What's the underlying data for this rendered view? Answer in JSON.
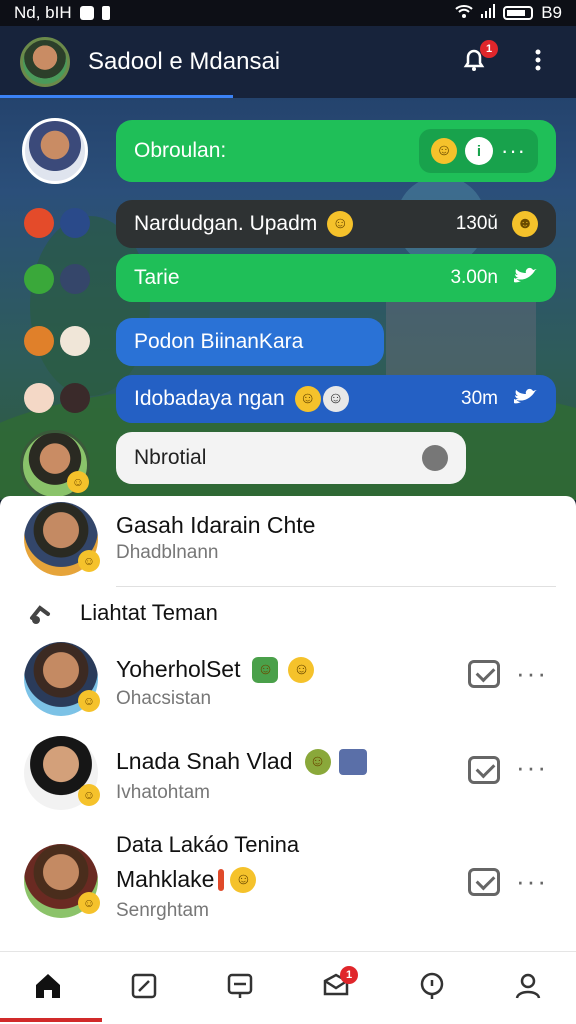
{
  "status_bar": {
    "carrier": "Nd, bIH",
    "time": "B9"
  },
  "header": {
    "title": "Sadool e Mdansai",
    "notif_badge": "1"
  },
  "chat": [
    {
      "text": "Obroulan:",
      "emoji": "😊",
      "time": ""
    },
    {
      "text": "Nardudgan. Upadm",
      "time": "130ŭ"
    },
    {
      "text": "Tarie",
      "time": "3.00n"
    },
    {
      "text": "Podon BiinanKara",
      "time": ""
    },
    {
      "text": "Idobadaya ngan",
      "time": "30m"
    },
    {
      "text": "Nbrotial",
      "time": ""
    }
  ],
  "panel": {
    "top_item": {
      "name": "Gasah Idarain Chte",
      "sub": "Dhadblnann"
    },
    "section_label": "Liahtat Teman",
    "friends": [
      {
        "name": "YoherholSet",
        "sub": "Ohacsistan"
      },
      {
        "name": "Lnada Snah Vlad",
        "sub": "Ivhatohtam"
      },
      {
        "name": "Mahklake",
        "sub": "Senrghtam",
        "heading": "Data Lakáo Tenina"
      }
    ]
  },
  "nav": {
    "badge": "1"
  },
  "colors": {
    "green": "#1fbf58",
    "blue": "#2a72d6",
    "dark": "#2e3233",
    "accent": "#d12a2a"
  }
}
